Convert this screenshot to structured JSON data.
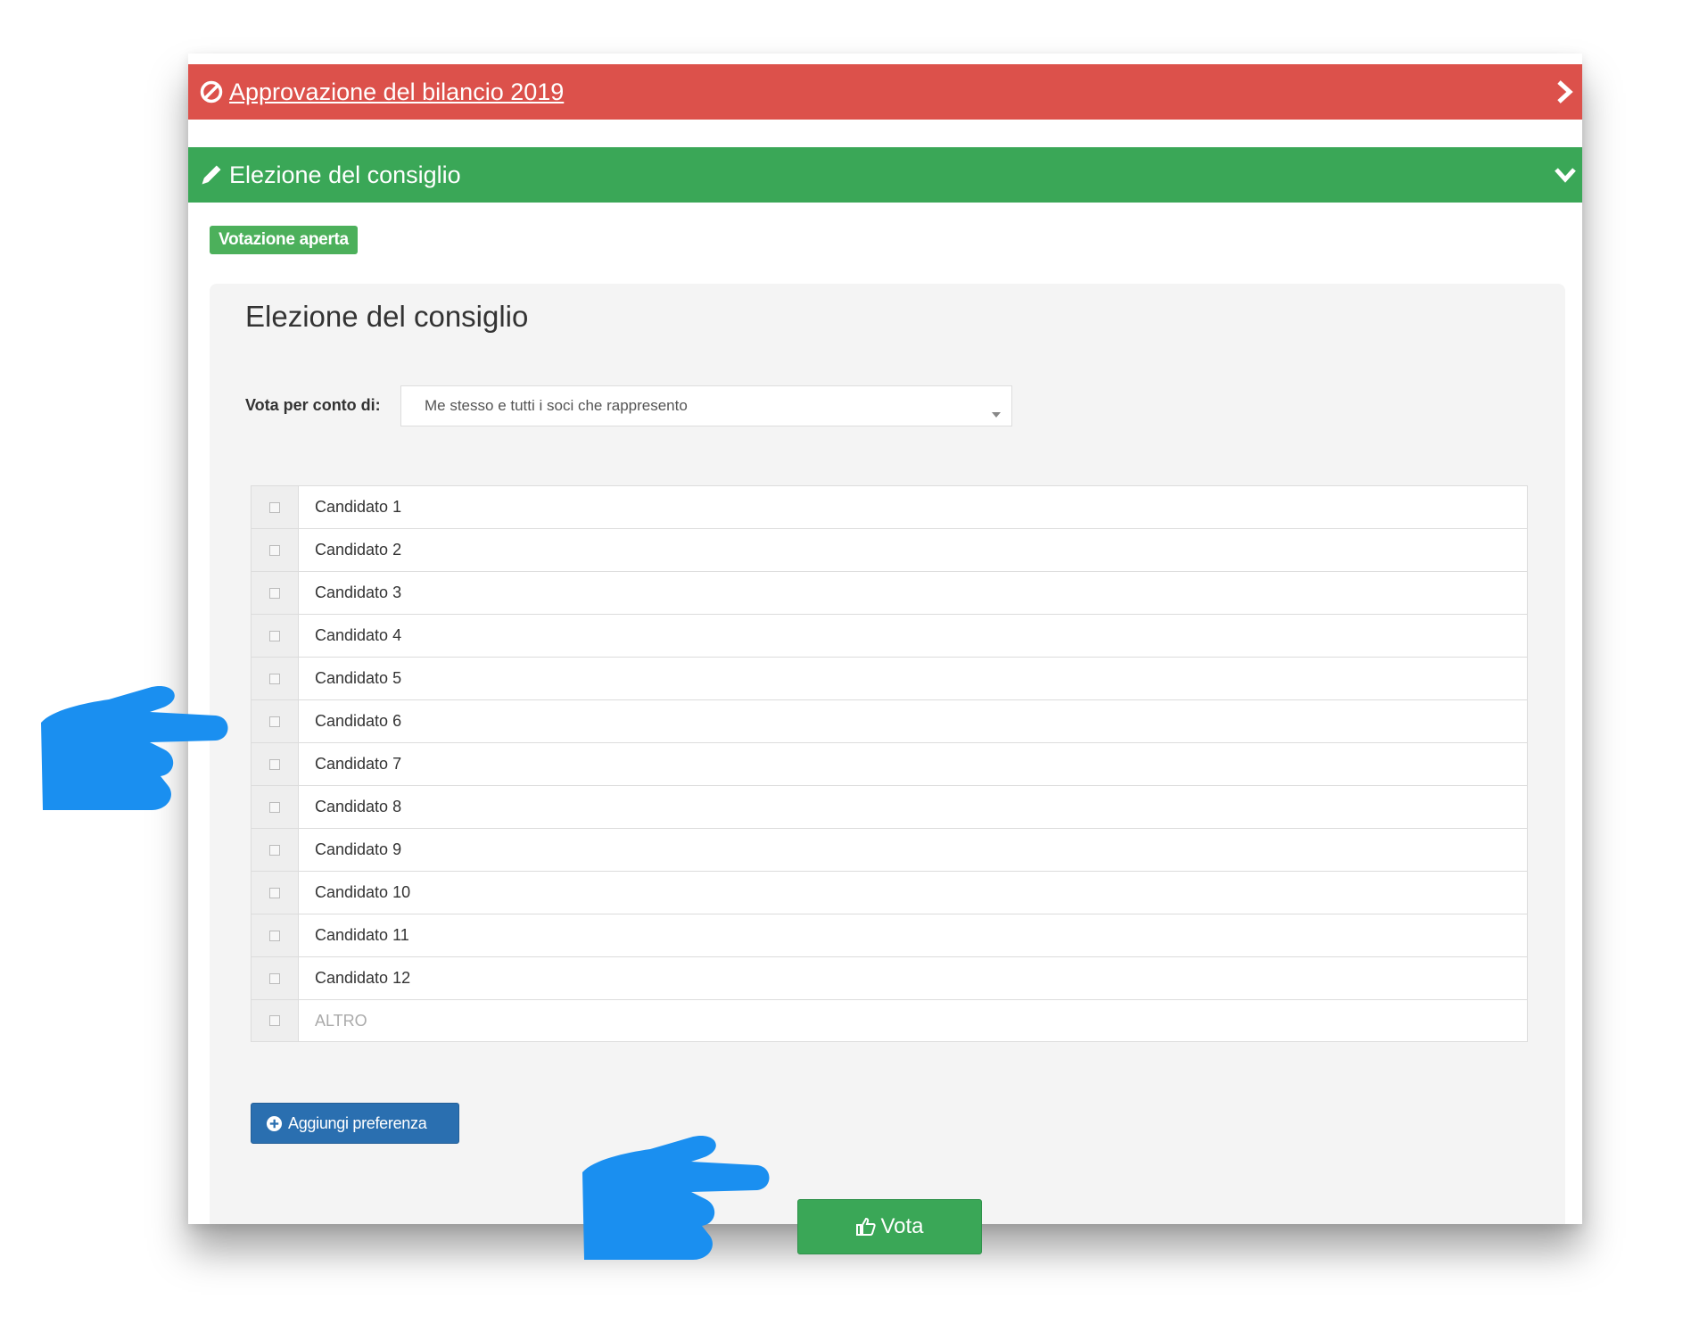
{
  "accordion": [
    {
      "title": "Approvazione del bilancio 2019",
      "icon": "ban-icon",
      "state_icon": "chevron-right-icon",
      "color": "#dc514b"
    },
    {
      "title": "Elezione del consiglio",
      "icon": "pencil-icon",
      "state_icon": "chevron-down-icon",
      "color": "#3aa757"
    }
  ],
  "status_badge": "Votazione aperta",
  "panel": {
    "title": "Elezione del consiglio",
    "vote_for_label": "Vota per conto di:",
    "vote_for_value": "Me stesso e tutti i soci che rappresento"
  },
  "candidates": [
    "Candidato 1",
    "Candidato 2",
    "Candidato 3",
    "Candidato 4",
    "Candidato 5",
    "Candidato 6",
    "Candidato 7",
    "Candidato 8",
    "Candidato 9",
    "Candidato 10",
    "Candidato 11",
    "Candidato 12"
  ],
  "other_placeholder": "ALTRO",
  "add_preference_label": "Aggiungi preferenza",
  "vote_button_label": "Vota",
  "colors": {
    "pointer": "#1a8ff0",
    "primary": "#2a6fb0",
    "success": "#3aa757",
    "danger": "#dc514b"
  }
}
